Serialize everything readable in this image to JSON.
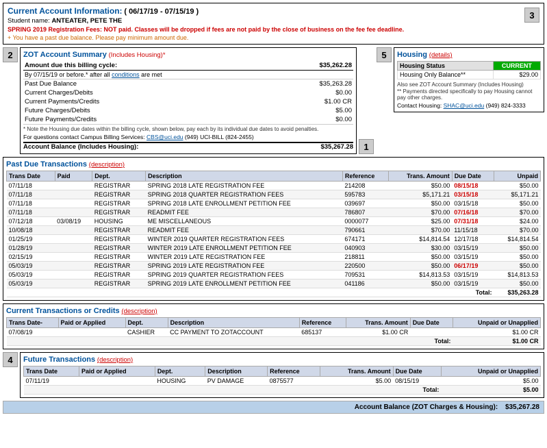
{
  "header": {
    "title": "Current Account Information:",
    "date_range": "( 06/17/19 - 07/15/19 )",
    "student_label": "Student name:",
    "student_name": "ANTEATER, PETE THE",
    "warning_red": "SPRING 2019 Registration Fees: NOT paid. Classes will be dropped if fees are not paid by the close of business on the fee fee deadline.",
    "warning_orange": "You have a past due balance. Please pay minimum amount due.",
    "badge": "3"
  },
  "zot_summary": {
    "title": "ZOT Account Summary",
    "subtitle": "(Includes Housing)*",
    "badge": "2",
    "billing_cycle_label": "Amount due this billing cycle:",
    "billing_cycle_amount": "$35,262.28",
    "by_date_label": "By 07/15/19 or before.*",
    "after_conditions_label": "after all",
    "conditions_link": "conditions",
    "after_conditions_suffix": "are met",
    "rows": [
      {
        "label": "Past Due Balance",
        "amount": "$35,263.28"
      },
      {
        "label": "Current Charges/Debits",
        "amount": "$0.00"
      },
      {
        "label": "Current Payments/Credits",
        "amount": "$1.00 CR"
      },
      {
        "label": "Future Charges/Debits",
        "amount": "$5.00"
      },
      {
        "label": "Future Payments/Credits",
        "amount": "$0.00"
      }
    ],
    "note": "* Note the Housing due dates within the billing cycle, shown below, pay each by its individual due dates to avoid penalties.",
    "contact": "For questions contact Campus Billing Services:",
    "contact_email": "CBS@uci.edu",
    "contact_phone": "(949) UCI-BILL (824-2455)",
    "total_label": "Account Balance (Includes Housing):",
    "total_amount": "$35,267.28",
    "badge_1": "1"
  },
  "housing": {
    "title": "Housing",
    "details_link": "(details)",
    "badge": "5",
    "status_label": "Housing Status",
    "status_value": "CURRENT",
    "balance_label": "Housing Only Balance**",
    "balance_value": "$29.00",
    "note1": "Also see ZOT Account Summary (Includes Housing)",
    "note2": "** Payments directed specifically to pay Housing cannot pay other charges.",
    "contact": "Contact Housing:",
    "contact_email": "SHAC@uci.edu",
    "contact_phone": "(949) 824-3333"
  },
  "past_due": {
    "title": "Past Due Transactions",
    "description_link": "(description)",
    "columns": [
      "Trans Date",
      "Paid",
      "Dept.",
      "Description",
      "Reference",
      "Trans. Amount",
      "Due Date",
      "Unpaid"
    ],
    "rows": [
      {
        "trans_date": "07/11/18",
        "paid": "",
        "dept": "REGISTRAR",
        "desc": "SPRING 2018 LATE REGISTRATION FEE",
        "ref": "214208",
        "amount": "$50.00",
        "due_date": "08/15/18",
        "due_red": true,
        "unpaid": "$50.00"
      },
      {
        "trans_date": "07/11/18",
        "paid": "",
        "dept": "REGISTRAR",
        "desc": "SPRING 2018 QUARTER REGISTRATION FEES",
        "ref": "595783",
        "amount": "$5,171.21",
        "due_date": "03/15/18",
        "due_red": true,
        "unpaid": "$5,171.21"
      },
      {
        "trans_date": "07/11/18",
        "paid": "",
        "dept": "REGISTRAR",
        "desc": "SPRING 2018 LATE ENROLLMENT PETITION FEE",
        "ref": "039697",
        "amount": "$50.00",
        "due_date": "03/15/18",
        "due_red": false,
        "unpaid": "$50.00"
      },
      {
        "trans_date": "07/11/18",
        "paid": "",
        "dept": "REGISTRAR",
        "desc": "READMIT FEE",
        "ref": "786807",
        "amount": "$70.00",
        "due_date": "07/16/18",
        "due_red": true,
        "unpaid": "$70.00"
      },
      {
        "trans_date": "07/12/18",
        "paid": "03/08/19",
        "dept": "HOUSING",
        "desc": "ME MISCELLANEOUS",
        "ref": "0000077",
        "amount": "$25.00",
        "due_date": "07/31/18",
        "due_red": true,
        "unpaid": "$24.00"
      },
      {
        "trans_date": "10/08/18",
        "paid": "",
        "dept": "REGISTRAR",
        "desc": "READMIT FEE",
        "ref": "790661",
        "amount": "$70.00",
        "due_date": "11/15/18",
        "due_red": false,
        "unpaid": "$70.00"
      },
      {
        "trans_date": "01/25/19",
        "paid": "",
        "dept": "REGISTRAR",
        "desc": "WINTER 2019 QUARTER REGISTRATION FEES",
        "ref": "674171",
        "amount": "$14,814.54",
        "due_date": "12/17/18",
        "due_red": false,
        "unpaid": "$14,814.54"
      },
      {
        "trans_date": "01/28/19",
        "paid": "",
        "dept": "REGISTRAR",
        "desc": "WINTER 2019 LATE ENROLLMENT PETITION FEE",
        "ref": "040903",
        "amount": "$30.00",
        "due_date": "03/15/19",
        "due_red": false,
        "unpaid": "$50.00"
      },
      {
        "trans_date": "02/15/19",
        "paid": "",
        "dept": "REGISTRAR",
        "desc": "WINTER 2019 LATE REGISTRATION FEE",
        "ref": "218811",
        "amount": "$50.00",
        "due_date": "03/15/19",
        "due_red": false,
        "unpaid": "$50.00"
      },
      {
        "trans_date": "05/03/19",
        "paid": "",
        "dept": "REGISTRAR",
        "desc": "SPRING 2019 LATE REGISTRATION FEE",
        "ref": "220500",
        "amount": "$50.00",
        "due_date": "06/17/19",
        "due_red": true,
        "unpaid": "$50.00"
      },
      {
        "trans_date": "05/03/19",
        "paid": "",
        "dept": "REGISTRAR",
        "desc": "SPRING 2019 QUARTER REGISTRATION FEES",
        "ref": "709531",
        "amount": "$14,813.53",
        "due_date": "03/15/19",
        "due_red": false,
        "unpaid": "$14,813.53"
      },
      {
        "trans_date": "05/03/19",
        "paid": "",
        "dept": "REGISTRAR",
        "desc": "SPRING 2019 LATE ENROLLMENT PETITION FEE",
        "ref": "041186",
        "amount": "$50.00",
        "due_date": "03/15/19",
        "due_red": false,
        "unpaid": "$50.00"
      }
    ],
    "total_label": "Total:",
    "total_amount": "$35,263.28"
  },
  "current_tx": {
    "title": "Current Transactions or Credits",
    "description_link": "(description)",
    "columns": [
      "Trans Date-",
      "Paid or Applied",
      "Dept.",
      "Description",
      "Reference",
      "Trans. Amount",
      "Due Date",
      "Unpaid or Unapplied"
    ],
    "rows": [
      {
        "trans_date": "07/08/19",
        "paid": "",
        "dept": "CASHIER",
        "desc": "CC PAYMENT TO ZOTACCOUNT",
        "ref": "685137",
        "amount": "$1.00 CR",
        "due_date": "",
        "unpaid": "$1.00 CR"
      }
    ],
    "total_label": "Total:",
    "total_amount": "$1.00 CR"
  },
  "future_tx": {
    "title": "Future Transactions",
    "description_link": "(description)",
    "badge": "4",
    "columns": [
      "Trans Date",
      "Paid or Applied",
      "Dept.",
      "Description",
      "Reference",
      "Trans. Amount",
      "Due Date",
      "Unpaid or Unapplied"
    ],
    "rows": [
      {
        "trans_date": "07/11/19",
        "paid": "",
        "dept": "HOUSING",
        "desc": "PV DAMAGE",
        "ref": "0875577",
        "amount": "$5.00",
        "due_date": "08/15/19",
        "unpaid": "$5.00"
      }
    ],
    "total_label": "Total:",
    "total_amount": "$5.00"
  },
  "account_balance": {
    "label": "Account Balance (ZOT Charges & Housing):",
    "amount": "$35,267.28"
  }
}
